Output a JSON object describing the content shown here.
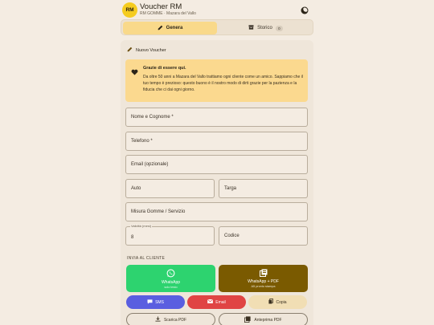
{
  "app": {
    "logo_text": "RM",
    "title": "Voucher RM",
    "subtitle": "RM GOMME · Mazara del Vallo"
  },
  "tabs": [
    {
      "label": "Genera",
      "active": true,
      "icon": "pencil-icon"
    },
    {
      "label": "Storico",
      "active": false,
      "icon": "archive-icon",
      "badge": "0"
    }
  ],
  "card": {
    "title": "Nuovo Voucher",
    "notice": {
      "title": "Grazie di essere qui.",
      "text": "Da oltre 50 anni a Mazara del Vallo trattiamo ogni cliente come un amico. Sappiamo che il tuo tempo è prezioso: questo buono è il nostro modo di dirti grazie per la pazienza e la fiducia che ci dai ogni giorno."
    },
    "fields": {
      "name": "Nome e Cognome *",
      "phone": "Telefono *",
      "email": "Email (opzionale)",
      "auto": "Auto",
      "targa": "Targa",
      "misura": "Misura Gomme / Servizio",
      "validity_label": "Validità (mesi)",
      "validity_value": "8",
      "codice": "Codice"
    },
    "send_section": "INVIA AL CLIENTE",
    "buttons": {
      "whatsapp": {
        "label": "WhatsApp",
        "sub": "solo testo"
      },
      "whatsapp_pdf": {
        "label": "WhatsApp + PDF",
        "sub": "A5 pronto stampa"
      },
      "sms": "SMS",
      "email": "Email",
      "copy": "Copia",
      "download_pdf": "Scarica PDF",
      "preview_pdf": "Anteprima PDF"
    }
  },
  "colors": {
    "background": "#f4ece2",
    "accent_yellow": "#f5cc1f",
    "whatsapp": "#2dd36f",
    "whatsapp_pdf": "#7a5a00",
    "sms": "#5a5ee0",
    "email": "#e04444"
  }
}
